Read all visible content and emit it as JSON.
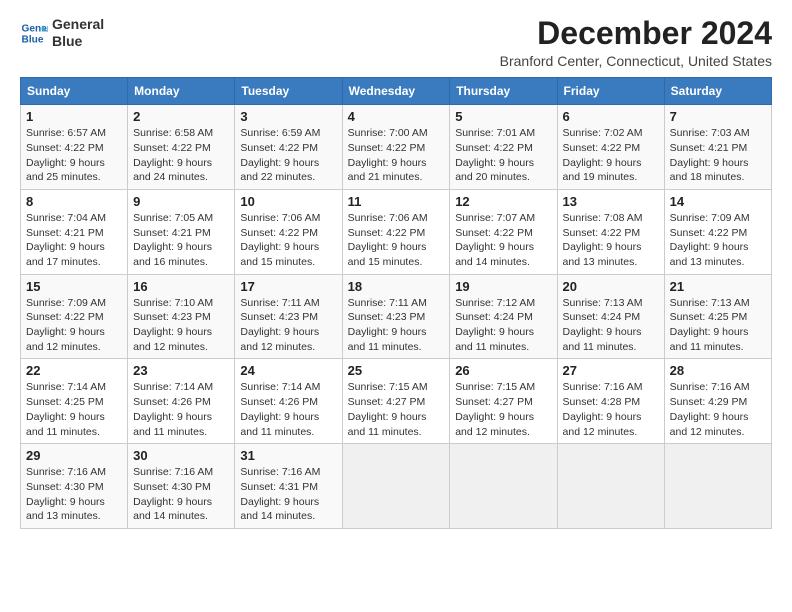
{
  "header": {
    "logo_line1": "General",
    "logo_line2": "Blue",
    "title": "December 2024",
    "subtitle": "Branford Center, Connecticut, United States"
  },
  "weekdays": [
    "Sunday",
    "Monday",
    "Tuesday",
    "Wednesday",
    "Thursday",
    "Friday",
    "Saturday"
  ],
  "weeks": [
    [
      {
        "day": "1",
        "info": "Sunrise: 6:57 AM\nSunset: 4:22 PM\nDaylight: 9 hours\nand 25 minutes."
      },
      {
        "day": "2",
        "info": "Sunrise: 6:58 AM\nSunset: 4:22 PM\nDaylight: 9 hours\nand 24 minutes."
      },
      {
        "day": "3",
        "info": "Sunrise: 6:59 AM\nSunset: 4:22 PM\nDaylight: 9 hours\nand 22 minutes."
      },
      {
        "day": "4",
        "info": "Sunrise: 7:00 AM\nSunset: 4:22 PM\nDaylight: 9 hours\nand 21 minutes."
      },
      {
        "day": "5",
        "info": "Sunrise: 7:01 AM\nSunset: 4:22 PM\nDaylight: 9 hours\nand 20 minutes."
      },
      {
        "day": "6",
        "info": "Sunrise: 7:02 AM\nSunset: 4:22 PM\nDaylight: 9 hours\nand 19 minutes."
      },
      {
        "day": "7",
        "info": "Sunrise: 7:03 AM\nSunset: 4:21 PM\nDaylight: 9 hours\nand 18 minutes."
      }
    ],
    [
      {
        "day": "8",
        "info": "Sunrise: 7:04 AM\nSunset: 4:21 PM\nDaylight: 9 hours\nand 17 minutes."
      },
      {
        "day": "9",
        "info": "Sunrise: 7:05 AM\nSunset: 4:21 PM\nDaylight: 9 hours\nand 16 minutes."
      },
      {
        "day": "10",
        "info": "Sunrise: 7:06 AM\nSunset: 4:22 PM\nDaylight: 9 hours\nand 15 minutes."
      },
      {
        "day": "11",
        "info": "Sunrise: 7:06 AM\nSunset: 4:22 PM\nDaylight: 9 hours\nand 15 minutes."
      },
      {
        "day": "12",
        "info": "Sunrise: 7:07 AM\nSunset: 4:22 PM\nDaylight: 9 hours\nand 14 minutes."
      },
      {
        "day": "13",
        "info": "Sunrise: 7:08 AM\nSunset: 4:22 PM\nDaylight: 9 hours\nand 13 minutes."
      },
      {
        "day": "14",
        "info": "Sunrise: 7:09 AM\nSunset: 4:22 PM\nDaylight: 9 hours\nand 13 minutes."
      }
    ],
    [
      {
        "day": "15",
        "info": "Sunrise: 7:09 AM\nSunset: 4:22 PM\nDaylight: 9 hours\nand 12 minutes."
      },
      {
        "day": "16",
        "info": "Sunrise: 7:10 AM\nSunset: 4:23 PM\nDaylight: 9 hours\nand 12 minutes."
      },
      {
        "day": "17",
        "info": "Sunrise: 7:11 AM\nSunset: 4:23 PM\nDaylight: 9 hours\nand 12 minutes."
      },
      {
        "day": "18",
        "info": "Sunrise: 7:11 AM\nSunset: 4:23 PM\nDaylight: 9 hours\nand 11 minutes."
      },
      {
        "day": "19",
        "info": "Sunrise: 7:12 AM\nSunset: 4:24 PM\nDaylight: 9 hours\nand 11 minutes."
      },
      {
        "day": "20",
        "info": "Sunrise: 7:13 AM\nSunset: 4:24 PM\nDaylight: 9 hours\nand 11 minutes."
      },
      {
        "day": "21",
        "info": "Sunrise: 7:13 AM\nSunset: 4:25 PM\nDaylight: 9 hours\nand 11 minutes."
      }
    ],
    [
      {
        "day": "22",
        "info": "Sunrise: 7:14 AM\nSunset: 4:25 PM\nDaylight: 9 hours\nand 11 minutes."
      },
      {
        "day": "23",
        "info": "Sunrise: 7:14 AM\nSunset: 4:26 PM\nDaylight: 9 hours\nand 11 minutes."
      },
      {
        "day": "24",
        "info": "Sunrise: 7:14 AM\nSunset: 4:26 PM\nDaylight: 9 hours\nand 11 minutes."
      },
      {
        "day": "25",
        "info": "Sunrise: 7:15 AM\nSunset: 4:27 PM\nDaylight: 9 hours\nand 11 minutes."
      },
      {
        "day": "26",
        "info": "Sunrise: 7:15 AM\nSunset: 4:27 PM\nDaylight: 9 hours\nand 12 minutes."
      },
      {
        "day": "27",
        "info": "Sunrise: 7:16 AM\nSunset: 4:28 PM\nDaylight: 9 hours\nand 12 minutes."
      },
      {
        "day": "28",
        "info": "Sunrise: 7:16 AM\nSunset: 4:29 PM\nDaylight: 9 hours\nand 12 minutes."
      }
    ],
    [
      {
        "day": "29",
        "info": "Sunrise: 7:16 AM\nSunset: 4:30 PM\nDaylight: 9 hours\nand 13 minutes."
      },
      {
        "day": "30",
        "info": "Sunrise: 7:16 AM\nSunset: 4:30 PM\nDaylight: 9 hours\nand 14 minutes."
      },
      {
        "day": "31",
        "info": "Sunrise: 7:16 AM\nSunset: 4:31 PM\nDaylight: 9 hours\nand 14 minutes."
      },
      null,
      null,
      null,
      null
    ]
  ]
}
